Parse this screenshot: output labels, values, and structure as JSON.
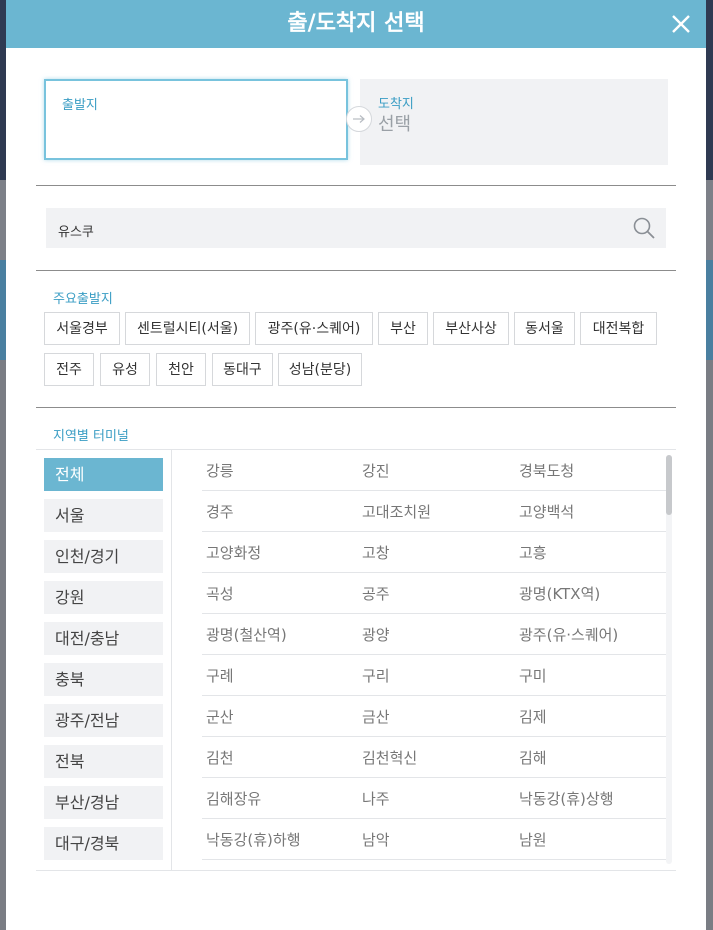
{
  "header": {
    "title": "출/도착지 선택"
  },
  "route": {
    "departure_label": "출발지",
    "arrival_label": "도착지",
    "arrival_value": "선택"
  },
  "search": {
    "value": "유스쿠"
  },
  "main_departures": {
    "title": "주요출발지",
    "items": [
      "서울경부",
      "센트럴시티(서울)",
      "광주(유·스퀘어)",
      "부산",
      "부산사상",
      "동서울",
      "대전복합",
      "전주",
      "유성",
      "천안",
      "동대구",
      "성남(분당)"
    ]
  },
  "regional": {
    "title": "지역별 터미널",
    "regions": [
      "전체",
      "서울",
      "인천/경기",
      "강원",
      "대전/충남",
      "충북",
      "광주/전남",
      "전북",
      "부산/경남",
      "대구/경북"
    ],
    "terminals": [
      [
        "강릉",
        "강진",
        "경북도청"
      ],
      [
        "경주",
        "고대조치원",
        "고양백석"
      ],
      [
        "고양화정",
        "고창",
        "고흥"
      ],
      [
        "곡성",
        "공주",
        "광명(KTX역)"
      ],
      [
        "광명(철산역)",
        "광양",
        "광주(유·스퀘어)"
      ],
      [
        "구례",
        "구리",
        "구미"
      ],
      [
        "군산",
        "금산",
        "김제"
      ],
      [
        "김천",
        "김천혁신",
        "김해"
      ],
      [
        "김해장유",
        "나주",
        "낙동강(휴)상행"
      ],
      [
        "낙동강(휴)하행",
        "남악",
        "남원"
      ]
    ]
  },
  "colors": {
    "accent": "#6bb6d1",
    "label": "#3a9dc4"
  }
}
